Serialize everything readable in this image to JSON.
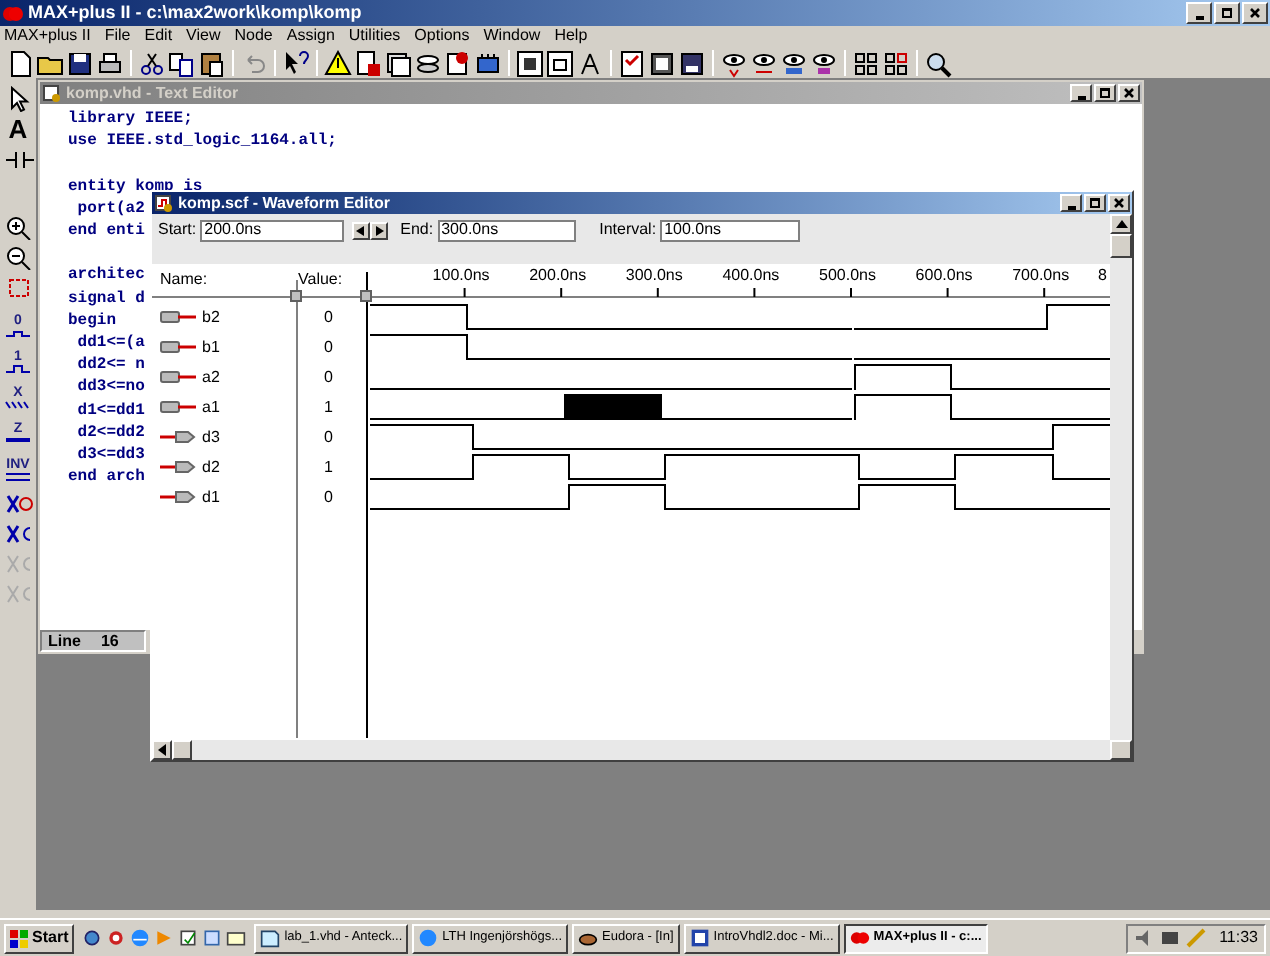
{
  "window": {
    "title": "MAX+plus II - c:\\max2work\\komp\\komp"
  },
  "menu": [
    "MAX+plus II",
    "File",
    "Edit",
    "View",
    "Node",
    "Assign",
    "Utilities",
    "Options",
    "Window",
    "Help"
  ],
  "palette": [
    {
      "label": "A"
    },
    {
      "label": "0"
    },
    {
      "label": "1"
    },
    {
      "label": "X"
    },
    {
      "label": "Z"
    },
    {
      "label": "INV"
    }
  ],
  "text_editor": {
    "title": "komp.vhd - Text Editor",
    "lines": [
      {
        "text": "library IEEE;",
        "blank_line_before": false
      },
      {
        "text": "use IEEE.std_logic_1164.all;",
        "blank_line_before": false
      },
      {
        "text": "entity komp is",
        "blank_line_before": true
      },
      {
        "text": " port(a2",
        "blank_line_before": false
      },
      {
        "text": "end enti",
        "blank_line_before": false
      },
      {
        "text": "architec",
        "blank_line_before": true
      },
      {
        "text": "signal d",
        "blank_line_before": false
      },
      {
        "text": "begin",
        "blank_line_before": false
      },
      {
        "text": " dd1<=(a",
        "blank_line_before": false
      },
      {
        "text": " dd2<= n",
        "blank_line_before": false
      },
      {
        "text": " dd3<=no",
        "blank_line_before": false
      },
      {
        "text": " d1<=dd1",
        "blank_line_before": false
      },
      {
        "text": " d2<=dd2",
        "blank_line_before": false
      },
      {
        "text": " d3<=dd3",
        "blank_line_before": false
      },
      {
        "text": "end arch",
        "blank_line_before": false
      }
    ],
    "status": {
      "label": "Line",
      "value": "16"
    }
  },
  "waveform_editor": {
    "title": "komp.scf - Waveform Editor",
    "fields": [
      {
        "label": "Start:",
        "value": "200.0ns"
      },
      {
        "label": "End:",
        "value": "300.0ns"
      },
      {
        "label": "Interval:",
        "value": "100.0ns"
      }
    ],
    "columns": [
      "Name:",
      "Value:"
    ],
    "ruler": [
      "100.0ns",
      "200.0ns",
      "300.0ns",
      "400.0ns",
      "500.0ns",
      "600.0ns",
      "700.0ns",
      "8"
    ],
    "signals": [
      {
        "name": "b2",
        "kind": "input",
        "value": "0",
        "selected": false,
        "high": [
          true,
          false,
          false,
          false,
          false,
          false,
          false,
          true
        ]
      },
      {
        "name": "b1",
        "kind": "input",
        "value": "0",
        "selected": false,
        "high": [
          true,
          false,
          false,
          false,
          false,
          false,
          false,
          false
        ]
      },
      {
        "name": "a2",
        "kind": "input",
        "value": "0",
        "selected": false,
        "high": [
          false,
          false,
          false,
          false,
          false,
          true,
          false,
          false
        ]
      },
      {
        "name": "a1",
        "kind": "input",
        "value": "1",
        "selected": true,
        "high": [
          false,
          false,
          true,
          false,
          false,
          true,
          false,
          false
        ]
      },
      {
        "name": "d3",
        "kind": "output",
        "value": "0",
        "selected": false,
        "high": [
          true,
          false,
          false,
          false,
          false,
          false,
          false,
          true
        ]
      },
      {
        "name": "d2",
        "kind": "output",
        "value": "1",
        "selected": false,
        "high": [
          false,
          true,
          false,
          true,
          true,
          false,
          true,
          false
        ]
      },
      {
        "name": "d1",
        "kind": "output",
        "value": "0",
        "selected": false,
        "high": [
          false,
          false,
          true,
          false,
          false,
          true,
          false,
          false
        ]
      }
    ]
  },
  "taskbar": {
    "start": "Start",
    "tasks": [
      {
        "label": "lab_1.vhd - Anteck...",
        "selected": false
      },
      {
        "label": "LTH Ingenjörshögs...",
        "selected": false
      },
      {
        "label": "Eudora - [In]",
        "selected": false
      },
      {
        "label": "IntroVhdl2.doc - Mi...",
        "selected": false
      },
      {
        "label": "MAX+plus II - c:...",
        "selected": true
      }
    ],
    "clock": "11:33"
  }
}
